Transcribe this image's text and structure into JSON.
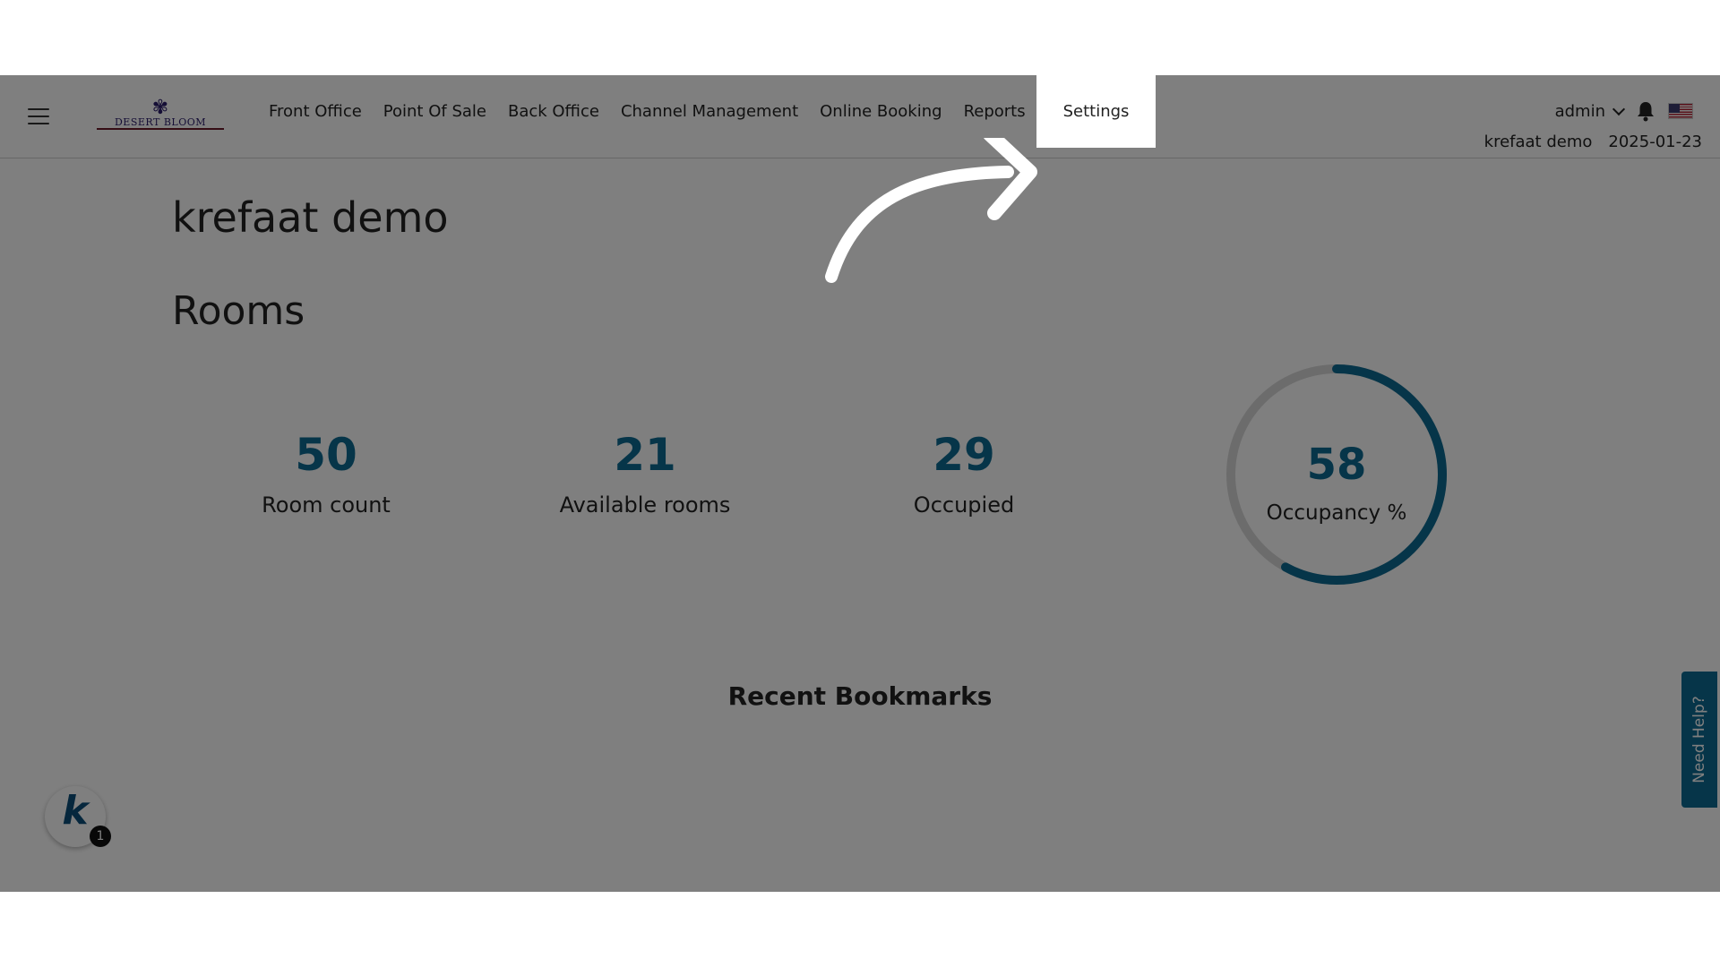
{
  "header": {
    "logo_text": "DESERT BLOOM",
    "nav": [
      {
        "label": "Front Office"
      },
      {
        "label": "Point Of Sale"
      },
      {
        "label": "Back Office"
      },
      {
        "label": "Channel Management"
      },
      {
        "label": "Online Booking"
      },
      {
        "label": "Reports"
      },
      {
        "label": "Settings",
        "active": true
      }
    ],
    "user": "admin",
    "hotel_name": "krefaat demo",
    "date": "2025-01-23"
  },
  "main": {
    "page_title": "krefaat demo",
    "section_title": "Rooms",
    "stats": [
      {
        "value": "50",
        "label": "Room count"
      },
      {
        "value": "21",
        "label": "Available rooms"
      },
      {
        "value": "29",
        "label": "Occupied"
      }
    ],
    "occupancy": {
      "value": "58",
      "label": "Occupancy %",
      "percent": 58
    },
    "bookmarks_title": "Recent Bookmarks"
  },
  "widgets": {
    "help_label": "Need Help?",
    "k_badge_count": "1"
  },
  "colors": {
    "accent": "#0d6b92",
    "overlay": "rgba(0,0,0,0.5)"
  }
}
